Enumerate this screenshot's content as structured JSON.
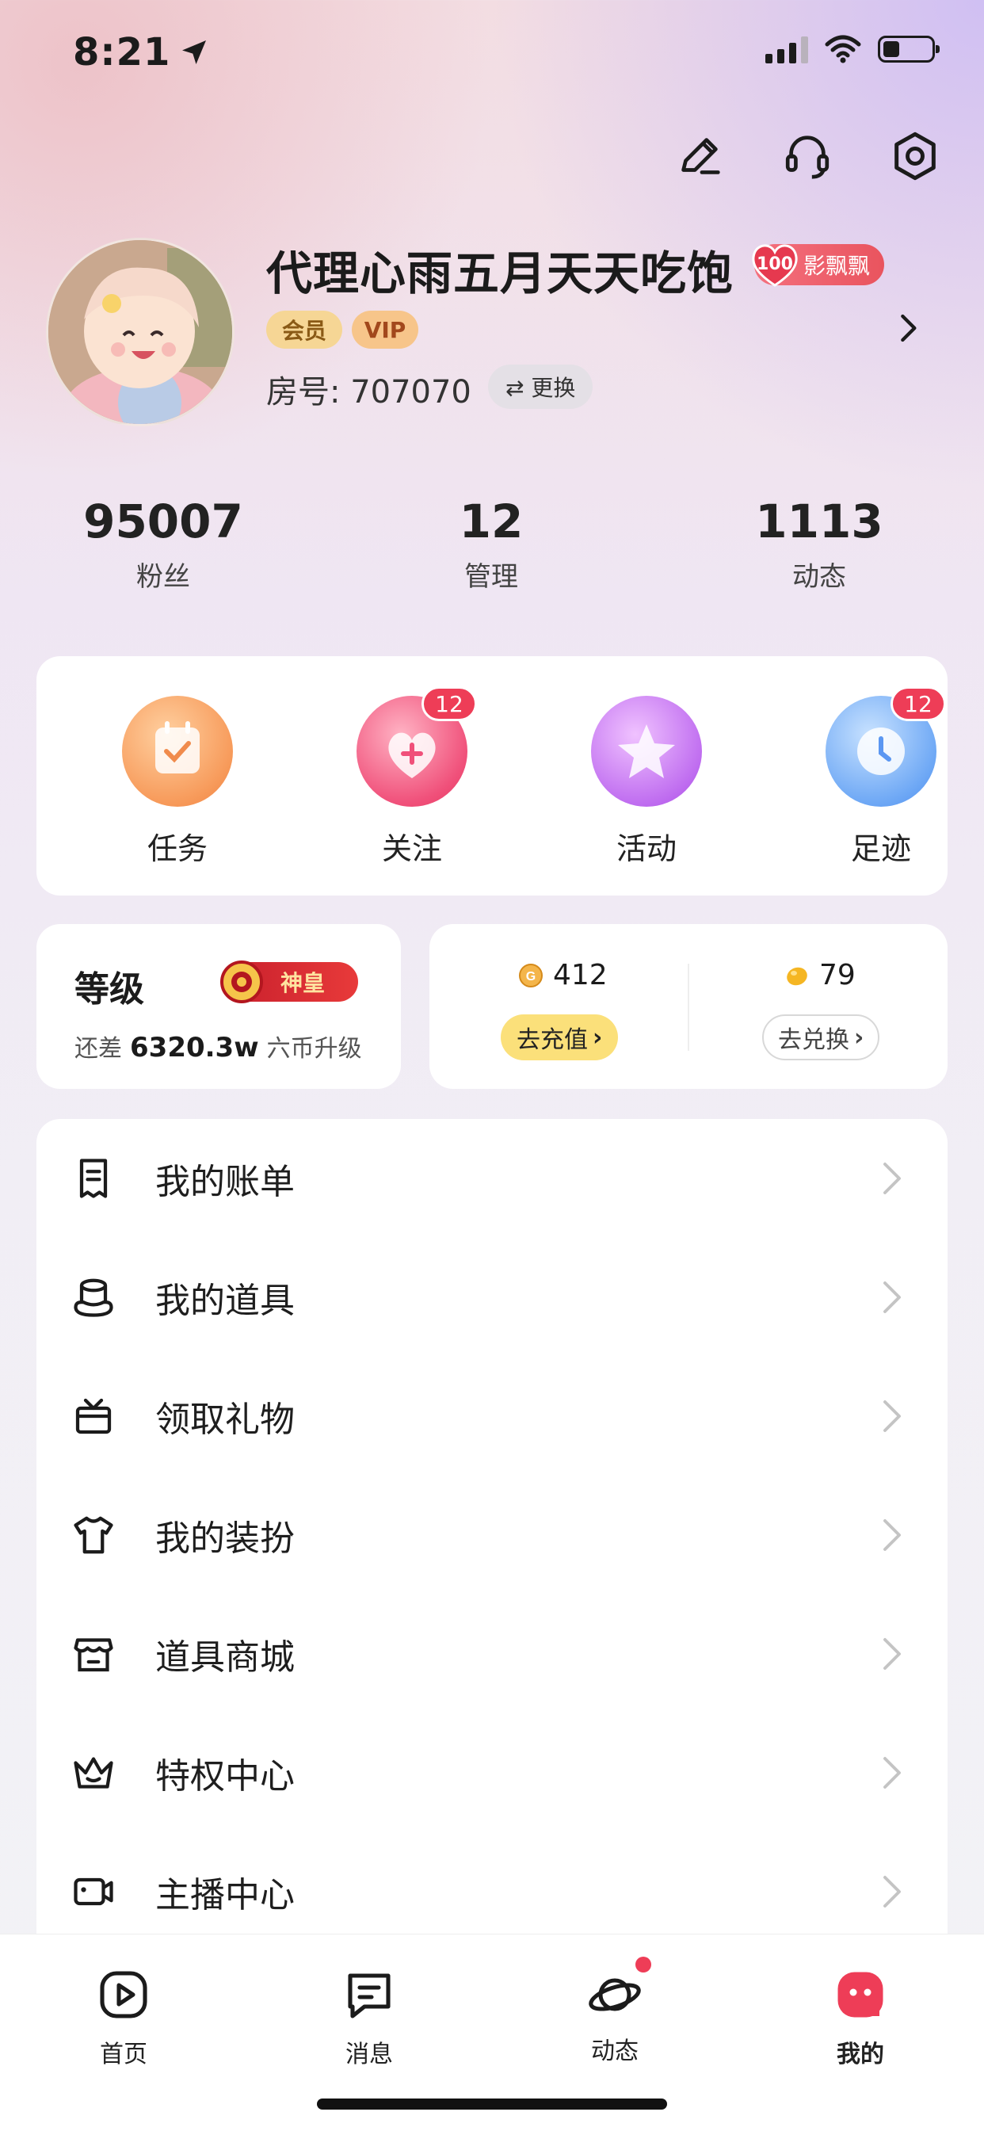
{
  "status": {
    "time": "8:21"
  },
  "profile": {
    "name": "代理心雨五月天天吃饱",
    "level_number": "100",
    "level_title": "影飘飘",
    "tags": [
      "会员",
      "VIP"
    ],
    "room_label": "房号: 707070",
    "swap_label": "⇄ 更换"
  },
  "stats": [
    {
      "value": "95007",
      "label": "粉丝"
    },
    {
      "value": "12",
      "label": "管理"
    },
    {
      "value": "1113",
      "label": "动态"
    }
  ],
  "quick": [
    {
      "label": "任务",
      "badge": ""
    },
    {
      "label": "关注",
      "badge": "12"
    },
    {
      "label": "活动",
      "badge": ""
    },
    {
      "label": "足迹",
      "badge": "12"
    }
  ],
  "level": {
    "title": "等级",
    "rank": "神皇",
    "prefix": "还差",
    "amount": "6320.3w",
    "suffix": "六币升级"
  },
  "coins": {
    "gold_value": "412",
    "gold_button": "去充值",
    "bean_value": "79",
    "bean_button": "去兑换"
  },
  "menu": [
    {
      "label": "我的账单",
      "icon": "bill-icon"
    },
    {
      "label": "我的道具",
      "icon": "props-icon"
    },
    {
      "label": "领取礼物",
      "icon": "gift-icon"
    },
    {
      "label": "我的装扮",
      "icon": "outfit-icon"
    },
    {
      "label": "道具商城",
      "icon": "store-icon"
    },
    {
      "label": "特权中心",
      "icon": "crown-icon"
    },
    {
      "label": "主播中心",
      "icon": "camera-icon"
    }
  ],
  "tabs": [
    {
      "label": "首页"
    },
    {
      "label": "消息"
    },
    {
      "label": "动态"
    },
    {
      "label": "我的"
    }
  ]
}
